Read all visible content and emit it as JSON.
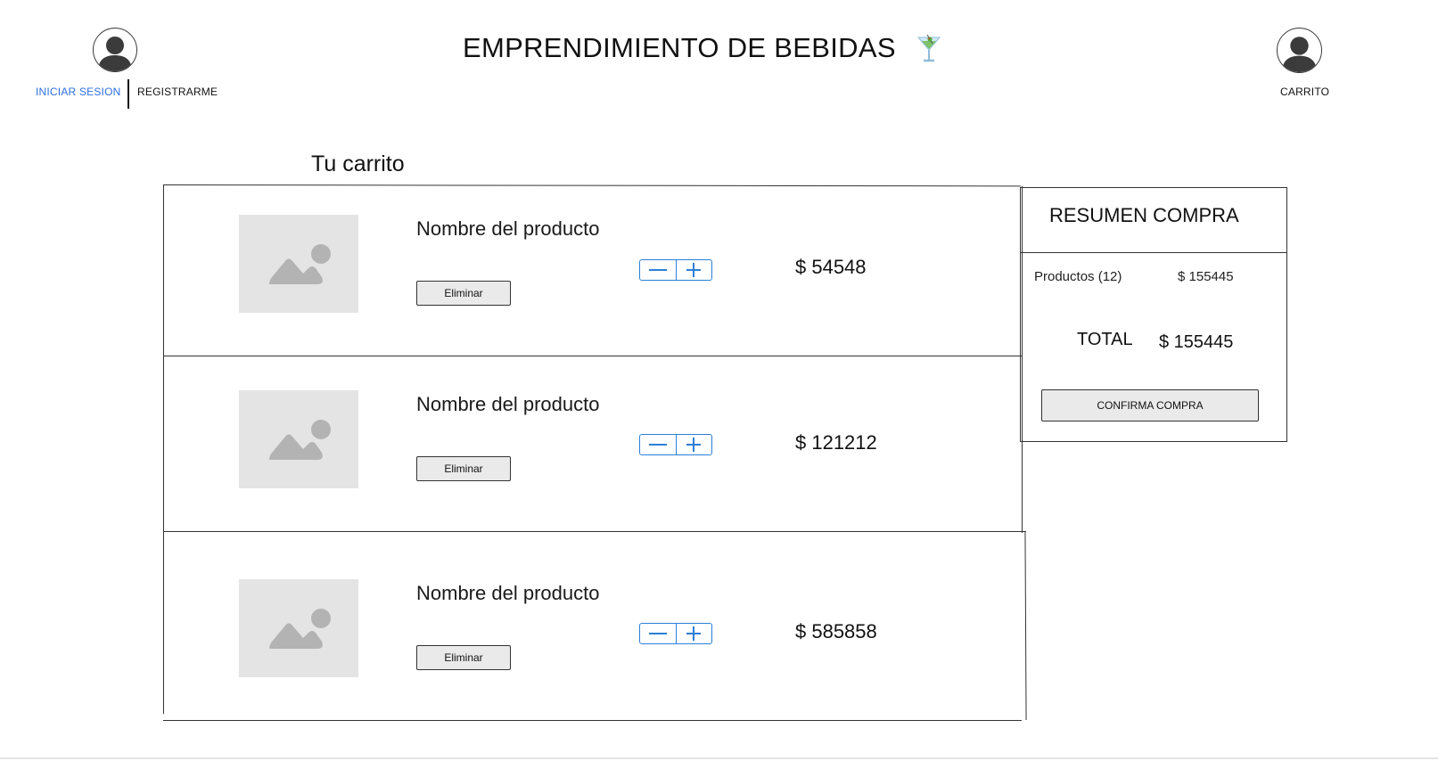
{
  "header": {
    "title": "EMPRENDIMIENTO DE BEBIDAS",
    "title_icon": "cocktail-icon",
    "login_label": "INICIAR SESION",
    "register_label": "REGISTRARME",
    "cart_label": "CARRITO",
    "user_icon": "user-avatar-icon",
    "cart_icon": "user-avatar-icon"
  },
  "cart": {
    "title": "Tu carrito",
    "items": [
      {
        "name": "Nombre del producto",
        "remove_label": "Eliminar",
        "price": "$ 54548",
        "image_icon": "image-placeholder-icon"
      },
      {
        "name": "Nombre del producto",
        "remove_label": "Eliminar",
        "price": "$ 121212",
        "image_icon": "image-placeholder-icon"
      },
      {
        "name": "Nombre del producto",
        "remove_label": "Eliminar",
        "price": "$ 585858",
        "image_icon": "image-placeholder-icon"
      }
    ],
    "stepper_minus_icon": "minus-icon",
    "stepper_plus_icon": "plus-icon"
  },
  "summary": {
    "title": "RESUMEN COMPRA",
    "products_label": "Productos (12)",
    "products_value": "$ 155445",
    "total_label": "TOTAL",
    "total_value": "$ 155445",
    "confirm_label": "CONFIRMA COMPRA"
  },
  "colors": {
    "link_blue": "#2f6fe0",
    "stepper_blue": "#2b7fd8",
    "placeholder_gray": "#e4e4e4",
    "button_gray": "#eaeaea"
  }
}
